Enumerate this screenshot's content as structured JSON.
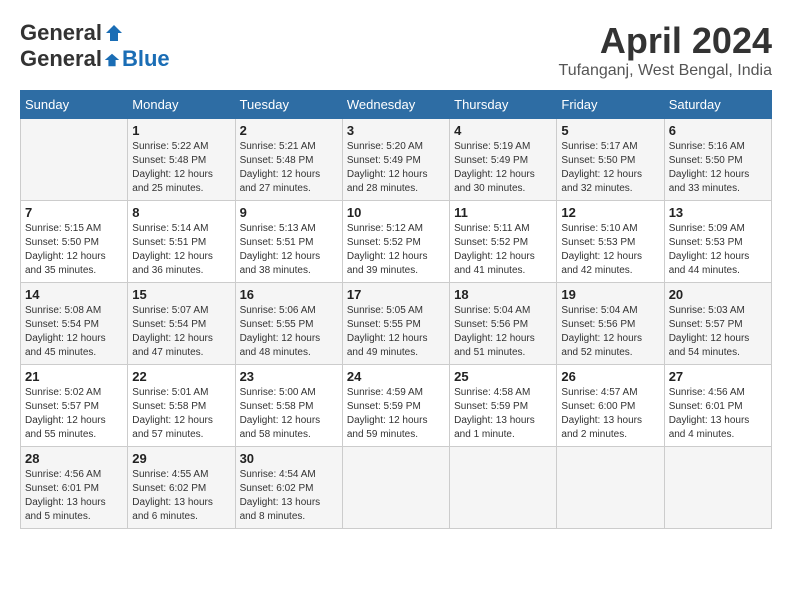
{
  "header": {
    "logo_general": "General",
    "logo_blue": "Blue",
    "month_year": "April 2024",
    "location": "Tufanganj, West Bengal, India"
  },
  "days_of_week": [
    "Sunday",
    "Monday",
    "Tuesday",
    "Wednesday",
    "Thursday",
    "Friday",
    "Saturday"
  ],
  "weeks": [
    [
      {
        "day": "",
        "info": ""
      },
      {
        "day": "1",
        "info": "Sunrise: 5:22 AM\nSunset: 5:48 PM\nDaylight: 12 hours\nand 25 minutes."
      },
      {
        "day": "2",
        "info": "Sunrise: 5:21 AM\nSunset: 5:48 PM\nDaylight: 12 hours\nand 27 minutes."
      },
      {
        "day": "3",
        "info": "Sunrise: 5:20 AM\nSunset: 5:49 PM\nDaylight: 12 hours\nand 28 minutes."
      },
      {
        "day": "4",
        "info": "Sunrise: 5:19 AM\nSunset: 5:49 PM\nDaylight: 12 hours\nand 30 minutes."
      },
      {
        "day": "5",
        "info": "Sunrise: 5:17 AM\nSunset: 5:50 PM\nDaylight: 12 hours\nand 32 minutes."
      },
      {
        "day": "6",
        "info": "Sunrise: 5:16 AM\nSunset: 5:50 PM\nDaylight: 12 hours\nand 33 minutes."
      }
    ],
    [
      {
        "day": "7",
        "info": "Sunrise: 5:15 AM\nSunset: 5:50 PM\nDaylight: 12 hours\nand 35 minutes."
      },
      {
        "day": "8",
        "info": "Sunrise: 5:14 AM\nSunset: 5:51 PM\nDaylight: 12 hours\nand 36 minutes."
      },
      {
        "day": "9",
        "info": "Sunrise: 5:13 AM\nSunset: 5:51 PM\nDaylight: 12 hours\nand 38 minutes."
      },
      {
        "day": "10",
        "info": "Sunrise: 5:12 AM\nSunset: 5:52 PM\nDaylight: 12 hours\nand 39 minutes."
      },
      {
        "day": "11",
        "info": "Sunrise: 5:11 AM\nSunset: 5:52 PM\nDaylight: 12 hours\nand 41 minutes."
      },
      {
        "day": "12",
        "info": "Sunrise: 5:10 AM\nSunset: 5:53 PM\nDaylight: 12 hours\nand 42 minutes."
      },
      {
        "day": "13",
        "info": "Sunrise: 5:09 AM\nSunset: 5:53 PM\nDaylight: 12 hours\nand 44 minutes."
      }
    ],
    [
      {
        "day": "14",
        "info": "Sunrise: 5:08 AM\nSunset: 5:54 PM\nDaylight: 12 hours\nand 45 minutes."
      },
      {
        "day": "15",
        "info": "Sunrise: 5:07 AM\nSunset: 5:54 PM\nDaylight: 12 hours\nand 47 minutes."
      },
      {
        "day": "16",
        "info": "Sunrise: 5:06 AM\nSunset: 5:55 PM\nDaylight: 12 hours\nand 48 minutes."
      },
      {
        "day": "17",
        "info": "Sunrise: 5:05 AM\nSunset: 5:55 PM\nDaylight: 12 hours\nand 49 minutes."
      },
      {
        "day": "18",
        "info": "Sunrise: 5:04 AM\nSunset: 5:56 PM\nDaylight: 12 hours\nand 51 minutes."
      },
      {
        "day": "19",
        "info": "Sunrise: 5:04 AM\nSunset: 5:56 PM\nDaylight: 12 hours\nand 52 minutes."
      },
      {
        "day": "20",
        "info": "Sunrise: 5:03 AM\nSunset: 5:57 PM\nDaylight: 12 hours\nand 54 minutes."
      }
    ],
    [
      {
        "day": "21",
        "info": "Sunrise: 5:02 AM\nSunset: 5:57 PM\nDaylight: 12 hours\nand 55 minutes."
      },
      {
        "day": "22",
        "info": "Sunrise: 5:01 AM\nSunset: 5:58 PM\nDaylight: 12 hours\nand 57 minutes."
      },
      {
        "day": "23",
        "info": "Sunrise: 5:00 AM\nSunset: 5:58 PM\nDaylight: 12 hours\nand 58 minutes."
      },
      {
        "day": "24",
        "info": "Sunrise: 4:59 AM\nSunset: 5:59 PM\nDaylight: 12 hours\nand 59 minutes."
      },
      {
        "day": "25",
        "info": "Sunrise: 4:58 AM\nSunset: 5:59 PM\nDaylight: 13 hours\nand 1 minute."
      },
      {
        "day": "26",
        "info": "Sunrise: 4:57 AM\nSunset: 6:00 PM\nDaylight: 13 hours\nand 2 minutes."
      },
      {
        "day": "27",
        "info": "Sunrise: 4:56 AM\nSunset: 6:01 PM\nDaylight: 13 hours\nand 4 minutes."
      }
    ],
    [
      {
        "day": "28",
        "info": "Sunrise: 4:56 AM\nSunset: 6:01 PM\nDaylight: 13 hours\nand 5 minutes."
      },
      {
        "day": "29",
        "info": "Sunrise: 4:55 AM\nSunset: 6:02 PM\nDaylight: 13 hours\nand 6 minutes."
      },
      {
        "day": "30",
        "info": "Sunrise: 4:54 AM\nSunset: 6:02 PM\nDaylight: 13 hours\nand 8 minutes."
      },
      {
        "day": "",
        "info": ""
      },
      {
        "day": "",
        "info": ""
      },
      {
        "day": "",
        "info": ""
      },
      {
        "day": "",
        "info": ""
      }
    ]
  ]
}
